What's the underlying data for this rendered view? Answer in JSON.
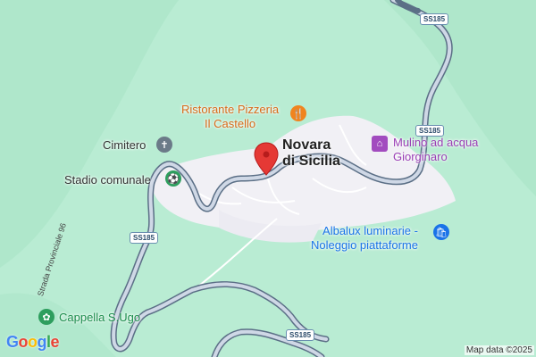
{
  "map": {
    "town": {
      "line1": "Novara",
      "line2": "di Sicilia"
    },
    "places": {
      "ristorante": {
        "line1": "Ristorante Pizzeria",
        "line2": "Il Castello",
        "icon": "restaurant-icon"
      },
      "mulino": {
        "line1": "Mulino ad acqua",
        "line2": "Giorginaro",
        "icon": "museum-icon"
      },
      "cimitero": {
        "label": "Cimitero",
        "icon": "cemetery-icon"
      },
      "stadio": {
        "label": "Stadio comunale",
        "icon": "stadium-icon"
      },
      "albalux": {
        "line1": "Albalux luminarie -",
        "line2": "Noleggio piattaforme",
        "icon": "shopping-bag-icon"
      },
      "cappella": {
        "label": "Cappella S.Ugo",
        "icon": "flower-icon"
      }
    },
    "road_shields": {
      "a": "SS185",
      "b": "SS185",
      "c": "SS185",
      "d": "SS185"
    },
    "street_label": "Strada Provinciale 96",
    "attribution": "Map data ©2025",
    "logo": "Google",
    "colors": {
      "terrain": "#b9ecd3",
      "urban": "#f1f0f5",
      "road_casing": "#5b6f86",
      "road_fill": "#cfd8e6",
      "pin": "#e53935",
      "restaurant": "#f0841f",
      "purple": "#a24bbf",
      "blue": "#1a73e8",
      "green": "#2e9e5e"
    }
  }
}
